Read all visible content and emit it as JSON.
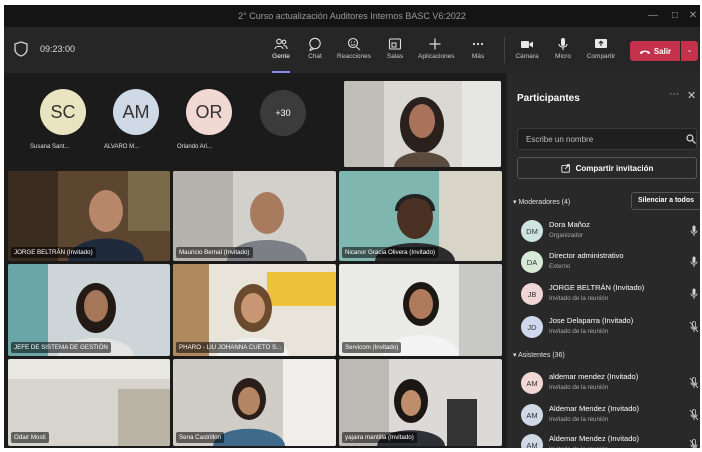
{
  "window": {
    "title": "2° Curso actualización Auditores Internos BASC V6:2022"
  },
  "toolbar": {
    "time": "09:23:00",
    "buttons": [
      {
        "label": "Gente",
        "icon": "people-icon"
      },
      {
        "label": "Chat",
        "icon": "chat-icon"
      },
      {
        "label": "Reacciones",
        "icon": "reactions-icon"
      },
      {
        "label": "Salas",
        "icon": "rooms-icon"
      },
      {
        "label": "Aplicaciones",
        "icon": "apps-icon"
      },
      {
        "label": "Más",
        "icon": "more-icon"
      },
      {
        "label": "Cámara",
        "icon": "camera-icon"
      },
      {
        "label": "Micro",
        "icon": "mic-icon"
      },
      {
        "label": "Compartir",
        "icon": "share-icon"
      }
    ],
    "leave_label": "Salir"
  },
  "stage": {
    "avatars": [
      {
        "initials": "SC",
        "name": "Susana Sant...",
        "color": "#e8e4bf"
      },
      {
        "initials": "AM",
        "name": "ALVARO M...",
        "color": "#cfd9e6"
      },
      {
        "initials": "OR",
        "name": "Orlando Ari...",
        "color": "#f2d8d3"
      }
    ],
    "more_count": "+30",
    "tiles": [
      {
        "name": "JORGE BELTRÁN (Invitado)"
      },
      {
        "name": "Mauricio Bernal (Invitado)"
      },
      {
        "name": "Nicanor Gracia Olivera (Invitado)"
      },
      {
        "name": "JEFE DE SISTEMA DE GESTIÓN"
      },
      {
        "name": "PHARO - LIU JOHANNA CUETO S..."
      },
      {
        "name": "Servicom (Invitado)"
      },
      {
        "name": "Odair Mosti"
      },
      {
        "name": "Sena Castrillon"
      },
      {
        "name": "yajaira mantilla (Invitado)"
      }
    ]
  },
  "panel": {
    "title": "Participantes",
    "search_placeholder": "Escribe un nombre",
    "share_label": "Compartir invitación",
    "moderators_label": "Moderadores (4)",
    "mute_all_label": "Silenciar a todos",
    "attendees_label": "Asistentes (36)",
    "moderators": [
      {
        "initials": "DM",
        "name": "Dora Mañoz",
        "role": "Organizador",
        "color": "#cfe3e0"
      },
      {
        "initials": "DA",
        "name": "Director administrativo",
        "role": "Externo",
        "color": "#d6ead6"
      },
      {
        "initials": "JB",
        "name": "JORGE BELTRÁN (Invitado)",
        "role": "Invitado de la reunión",
        "color": "#f0d6d6"
      },
      {
        "initials": "JD",
        "name": "Jose Delaparra (Invitado)",
        "role": "Invitado de la reunión",
        "color": "#cfd9ee"
      }
    ],
    "attendees": [
      {
        "initials": "AM",
        "name": "aldemar mendez (Invitado)",
        "role": "Invitado de la reunión",
        "color": "#f2d8d3"
      },
      {
        "initials": "AM",
        "name": "Aldemar Mendez (Invitado)",
        "role": "Invitado de la reunión",
        "color": "#cfd9e6"
      },
      {
        "initials": "AM",
        "name": "Aldemar Mendez (Invitado)",
        "role": "Invitado de la reunión",
        "color": "#cfd9e6"
      }
    ]
  }
}
